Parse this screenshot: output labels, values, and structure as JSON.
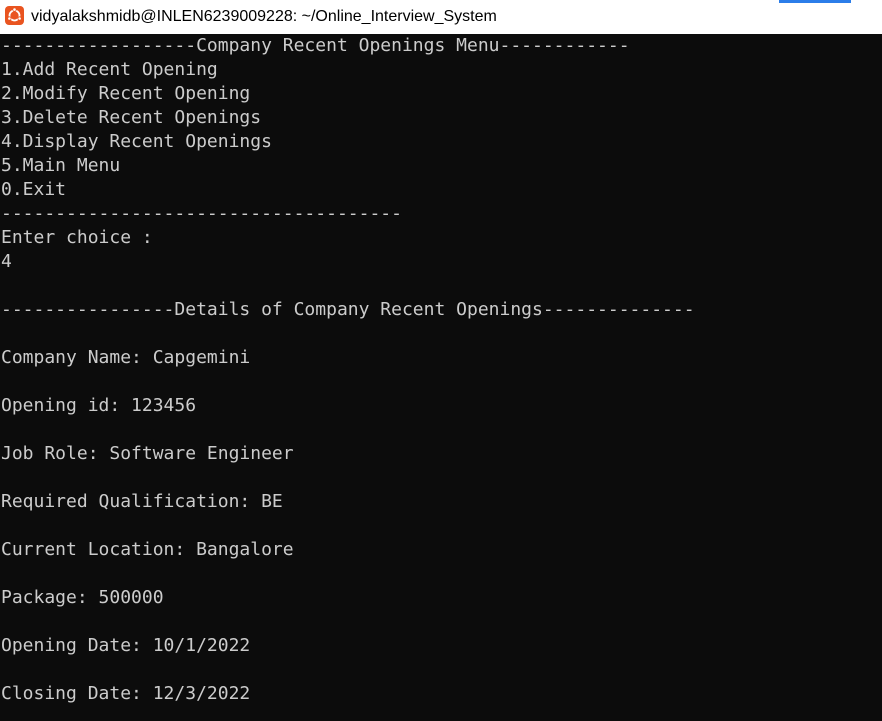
{
  "window": {
    "title": "vidyalakshmidb@INLEN6239009228: ~/Online_Interview_System",
    "app_icon": "ubuntu-icon",
    "icon_color": "#e95420",
    "accent_color": "#2b7de9"
  },
  "terminal": {
    "background": "#0c0c0c",
    "foreground": "#cccccc",
    "lines": [
      "------------------Company Recent Openings Menu------------",
      "1.Add Recent Opening",
      "2.Modify Recent Opening",
      "3.Delete Recent Openings",
      "4.Display Recent Openings",
      "5.Main Menu",
      "0.Exit",
      "-------------------------------------",
      "Enter choice :",
      "4",
      "",
      "----------------Details of Company Recent Openings--------------",
      "",
      "Company Name: Capgemini",
      "",
      "Opening id: 123456",
      "",
      "Job Role: Software Engineer",
      "",
      "Required Qualification: BE",
      "",
      "Current Location: Bangalore",
      "",
      "Package: 500000",
      "",
      "Opening Date: 10/1/2022",
      "",
      "Closing Date: 12/3/2022"
    ]
  }
}
